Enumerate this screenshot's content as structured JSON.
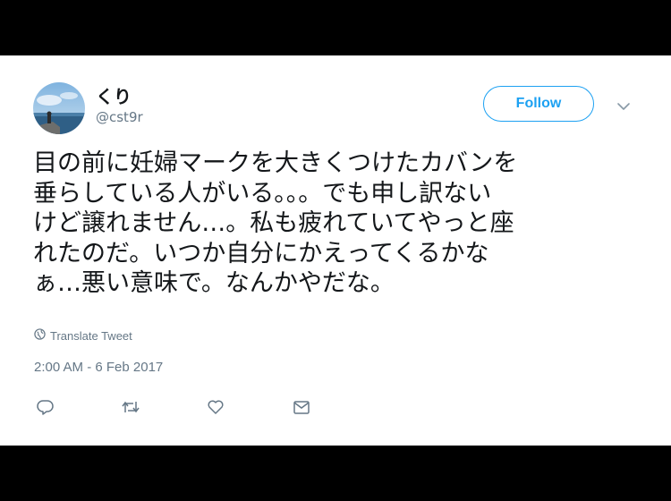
{
  "user": {
    "display_name": "くり",
    "handle": "@cst9r"
  },
  "follow_label": "Follow",
  "tweet": {
    "lines": [
      "目の前に妊婦マークを大きくつけたカバンを",
      "垂らしている人がいる。。。でも申し訳ない",
      "けど譲れません…。私も疲れていてやっと座",
      "れたのだ。いつか自分にかえってくるかな",
      "ぁ…悪い意味で。なんかやだな。"
    ]
  },
  "translate_label": "Translate Tweet",
  "timestamp": "2:00 AM - 6 Feb 2017",
  "icons": {
    "globe": "globe-icon",
    "caret": "chevron-down-icon",
    "reply": "reply-icon",
    "retweet": "retweet-icon",
    "like": "heart-icon",
    "message": "envelope-icon"
  },
  "colors": {
    "accent": "#1da1f2",
    "text": "#14171a",
    "secondary": "#657786",
    "background_frame": "#000000"
  }
}
